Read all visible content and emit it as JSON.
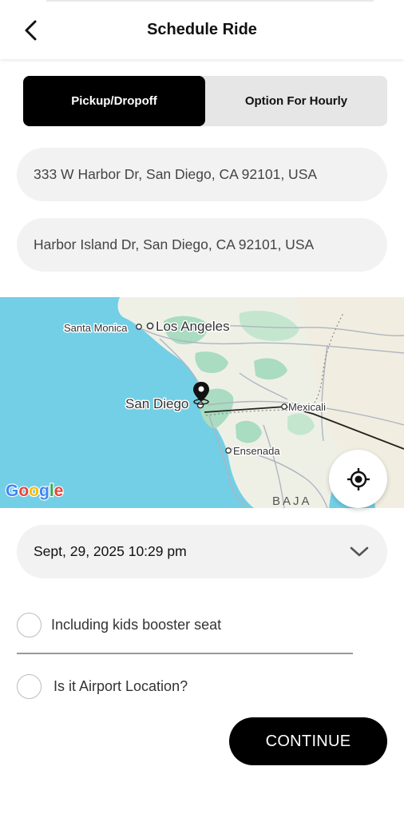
{
  "header": {
    "title": "Schedule Ride",
    "back_icon": "chevron-left-icon"
  },
  "tabs": [
    {
      "label": "Pickup/Dropoff",
      "active": true
    },
    {
      "label": "Option For Hourly",
      "active": false
    }
  ],
  "pickup": {
    "value": "333 W Harbor Dr, San Diego, CA 92101, USA"
  },
  "dropoff": {
    "value": "Harbor Island Dr, San Diego, CA 92101, USA"
  },
  "map": {
    "labels": {
      "santa_monica": "Santa Monica",
      "los_angeles": "Los Angeles",
      "san_diego": "San Diego",
      "mexicali": "Mexicali",
      "ensenada": "Ensenada",
      "baja": "BAJA",
      "google": "Google"
    },
    "locate_icon": "my-location-icon",
    "pin_icon": "map-pin-icon",
    "ocean_color": "#72cfe6",
    "land_color": "#eef0e6",
    "park_color": "#a9dcc0"
  },
  "schedule": {
    "datetime": "Sept, 29, 2025 10:29 pm",
    "chevron_icon": "chevron-down-icon"
  },
  "options": [
    {
      "label": "Including kids booster seat",
      "checked": false
    },
    {
      "label": "Is it Airport Location?",
      "checked": false
    }
  ],
  "actions": {
    "continue_label": "CONTINUE"
  },
  "colors": {
    "primary": "#000000",
    "field_bg": "#f2f2f2",
    "segment_bg": "#e6e6e6"
  }
}
